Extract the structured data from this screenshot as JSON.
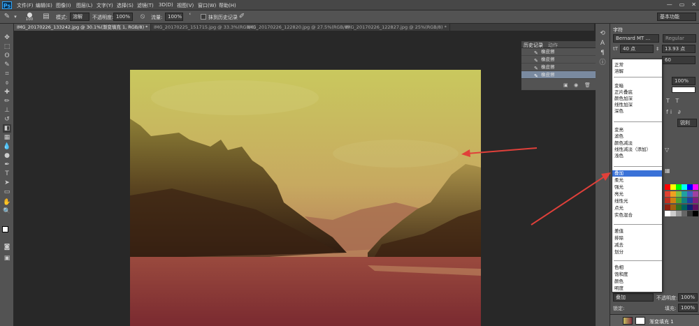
{
  "app": {
    "logo": "Ps"
  },
  "menubar": {
    "items": [
      "文件(F)",
      "编辑(E)",
      "图像(I)",
      "图层(L)",
      "文字(Y)",
      "选择(S)",
      "滤镜(T)",
      "3D(D)",
      "视图(V)",
      "窗口(W)",
      "帮助(H)"
    ],
    "window_controls": [
      "—",
      "▭",
      "✕"
    ]
  },
  "options": {
    "brush_size": "100",
    "mode_label": "模式:",
    "mode_value": "溶解",
    "opacity_label": "不透明度:",
    "opacity_value": "100%",
    "flow_label": "流量:",
    "flow_value": "100%",
    "erase_history_label": "抹到历史记录",
    "workspace": "基本功能"
  },
  "tabs": [
    "IMG_20170226_133242.jpg @ 30.1%(渐变填充 1, RGB/8) *",
    "IMG_20170225_151715.jpg @ 33.3%(RGB/8)",
    "IMG_20170226_122820.jpg @ 27.5%(RGB/8)",
    "IMG_20170226_122827.jpg @ 25%(RGB/8) *"
  ],
  "history": {
    "tab_history": "历史记录",
    "tab_actions": "动作",
    "rows": [
      "橡皮擦",
      "橡皮擦",
      "橡皮擦",
      "橡皮擦"
    ]
  },
  "character": {
    "title": "字符",
    "font_family": "Bernard MT ...",
    "font_style": "Regular",
    "font_size": "40 点",
    "leading": "13.93 点",
    "tracking": "60",
    "scale": "100%",
    "sharp": "锐利"
  },
  "blend_modes": {
    "groups": [
      [
        "正常",
        "溶解"
      ],
      [
        "变暗",
        "正片叠底",
        "颜色加深",
        "线性加深",
        "深色"
      ],
      [
        "变亮",
        "滤色",
        "颜色减淡",
        "线性减淡（添加）",
        "浅色"
      ],
      [
        "叠加",
        "柔光",
        "强光",
        "亮光",
        "线性光",
        "点光",
        "实色混合"
      ],
      [
        "差值",
        "排除",
        "减去",
        "划分"
      ],
      [
        "色相",
        "饱和度",
        "颜色",
        "明度"
      ]
    ],
    "selected": "叠加"
  },
  "layers": {
    "blend_value": "叠加",
    "opacity_label": "不透明度:",
    "opacity_value": "100%",
    "lock_label": "锁定:",
    "fill_label": "填充:",
    "fill_value": "100%",
    "layer_name": "渐变填充 1"
  },
  "colors": {
    "accent_arrow": "#e0403a",
    "selection": "#3a72d8"
  }
}
